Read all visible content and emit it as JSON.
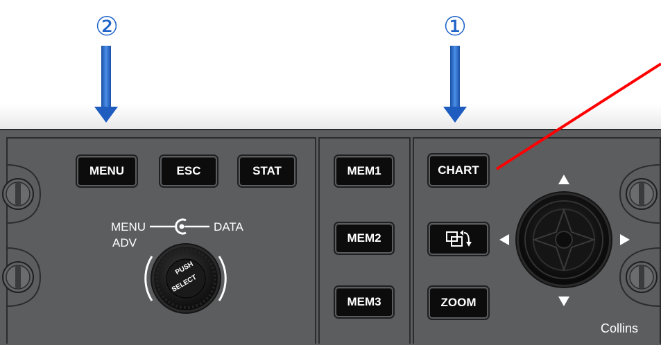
{
  "callouts": [
    "②",
    "①"
  ],
  "left_keys": {
    "menu": "MENU",
    "esc": "ESC",
    "stat": "STAT"
  },
  "knob": {
    "label_menu": "MENU",
    "label_data": "DATA",
    "label_adv": "ADV",
    "push_text": "PUSH",
    "select_text": "SELECT"
  },
  "mem_keys": [
    "MEM1",
    "MEM2",
    "MEM3"
  ],
  "right_keys": {
    "chart": "CHART",
    "zoom": "ZOOM"
  },
  "icons": {
    "swap": "window-swap-icon",
    "joystick": "joystick-icon",
    "up": "triangle-up-icon",
    "down": "triangle-down-icon",
    "left": "triangle-left-icon",
    "right": "triangle-right-icon"
  },
  "brand": "Collins",
  "colors": {
    "panel": "#5b5d5f",
    "key": "#0c0c0c",
    "callout_blue": "#1f63c8",
    "pointer_red": "#ff0000"
  }
}
